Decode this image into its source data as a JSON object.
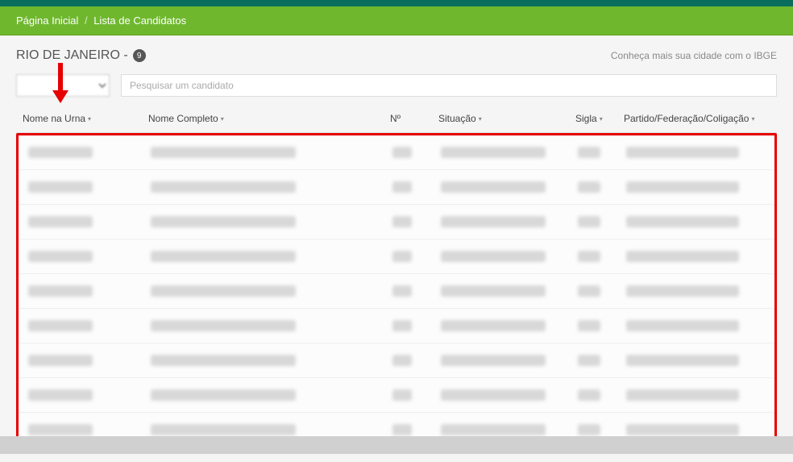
{
  "breadcrumb": {
    "home": "Página Inicial",
    "current": "Lista de Candidatos"
  },
  "title": {
    "city": "RIO DE JANEIRO -",
    "count": "9"
  },
  "ibge_link": "Conheça mais sua cidade com o IBGE",
  "controls": {
    "select_placeholder": "",
    "search_placeholder": "Pesquisar um candidato"
  },
  "columns": {
    "nome_urna": "Nome na Urna",
    "nome_completo": "Nome Completo",
    "numero": "Nº",
    "situacao": "Situação",
    "sigla": "Sigla",
    "partido": "Partido/Federação/Coligação"
  },
  "rows": [
    {},
    {},
    {},
    {},
    {},
    {},
    {},
    {},
    {}
  ],
  "ui": {
    "caret": "▾"
  }
}
